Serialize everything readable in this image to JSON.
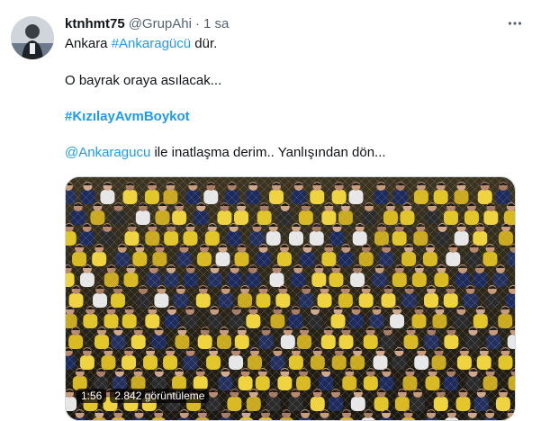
{
  "tweet": {
    "author_name": "ktnhmt75",
    "handle": "@GrupAhi",
    "separator": "·",
    "time": "1 sa",
    "more_icon": "ellipsis-icon",
    "line1_prefix": "Ankara ",
    "line1_hashtag": "#Ankaragücü",
    "line1_suffix": " dür.",
    "line2": "O bayrak oraya asılacak...",
    "line3_hashtag": "#KızılayAvmBoykot",
    "line4_mention": "@Ankaragucu",
    "line4_text": " ile inatlaşma derim.. Yanlışından dön...",
    "video": {
      "duration": "1:56",
      "views": "2.842 görüntüleme"
    }
  },
  "colors": {
    "link": "#1d9bf0",
    "text": "#0f1419",
    "secondary": "#536471"
  }
}
